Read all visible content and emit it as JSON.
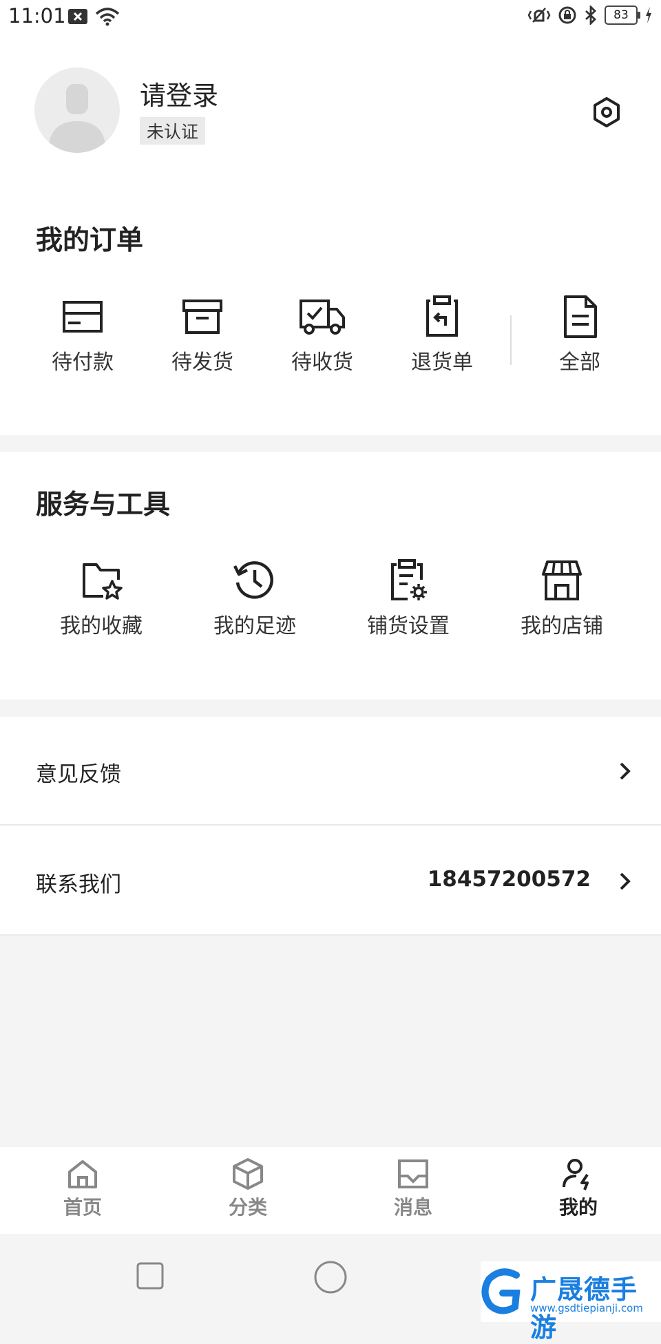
{
  "status_bar": {
    "time": "11:01",
    "battery": "83",
    "icons": [
      "notification-x-icon",
      "wifi-icon",
      "vibrate-icon",
      "rotation-lock-icon",
      "bluetooth-icon",
      "battery-icon",
      "charging-icon"
    ]
  },
  "profile": {
    "login_text": "请登录",
    "cert_badge": "未认证"
  },
  "orders": {
    "title": "我的订单",
    "items": [
      {
        "label": "待付款",
        "icon": "card-icon"
      },
      {
        "label": "待发货",
        "icon": "box-icon"
      },
      {
        "label": "待收货",
        "icon": "truck-icon"
      },
      {
        "label": "退货单",
        "icon": "return-clipboard-icon"
      },
      {
        "label": "全部",
        "icon": "document-icon"
      }
    ]
  },
  "services": {
    "title": "服务与工具",
    "items": [
      {
        "label": "我的收藏",
        "icon": "folder-star-icon"
      },
      {
        "label": "我的足迹",
        "icon": "history-icon"
      },
      {
        "label": "铺货设置",
        "icon": "clipboard-gear-icon"
      },
      {
        "label": "我的店铺",
        "icon": "store-icon"
      }
    ]
  },
  "rows": {
    "feedback": {
      "label": "意见反馈"
    },
    "contact": {
      "label": "联系我们",
      "value": "18457200572"
    }
  },
  "tabbar": {
    "tabs": [
      {
        "label": "首页",
        "icon": "home-icon"
      },
      {
        "label": "分类",
        "icon": "cube-icon"
      },
      {
        "label": "消息",
        "icon": "inbox-icon"
      },
      {
        "label": "我的",
        "icon": "user-icon",
        "active": true
      }
    ]
  },
  "watermark": {
    "text": "广晟德手游",
    "sub": "www.gsdtiepianji.com"
  },
  "colors": {
    "accent": "#222222",
    "inactive": "#888888",
    "watermark": "#1a7fe0"
  }
}
